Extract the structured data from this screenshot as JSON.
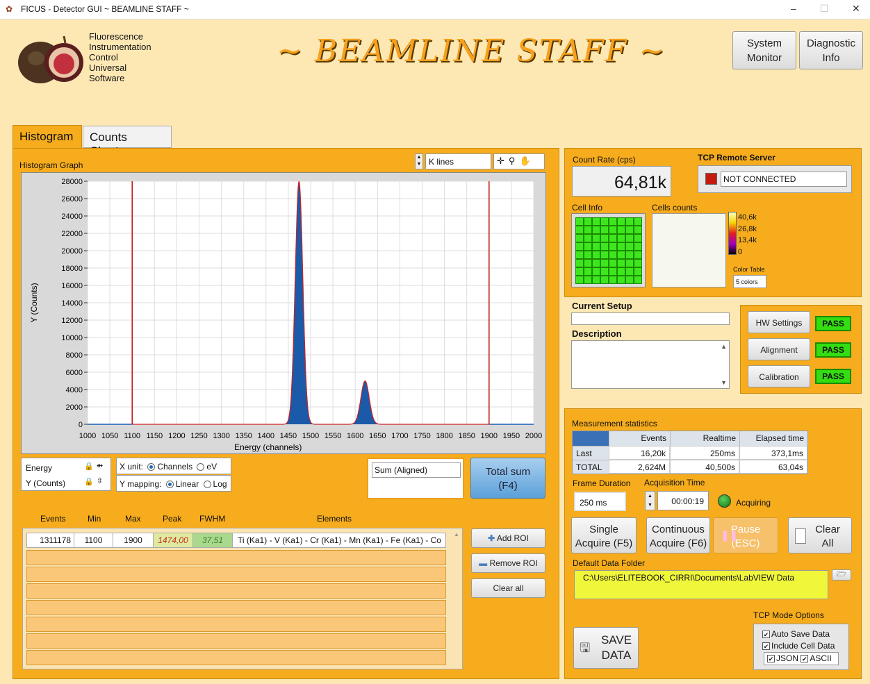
{
  "window": {
    "title": "FICUS - Detector GUI ~ BEAMLINE STAFF ~",
    "minimize": "–",
    "maximize": "☐",
    "close": "✕"
  },
  "logo": {
    "lines": [
      "Fluorescence",
      "Instrumentation",
      "Control",
      "Universal",
      "Software"
    ]
  },
  "banner": "~ BEAMLINE STAFF ~",
  "header_buttons": {
    "system_monitor": "System Monitor",
    "diagnostic_info": "Diagnostic Info"
  },
  "tabs": [
    "Histogram",
    "Counts Charts"
  ],
  "histogram": {
    "title": "Histogram Graph",
    "line_selector": "K lines",
    "xlabel": "Energy (channels)",
    "ylabel": "Y (Counts)"
  },
  "chart_data": {
    "type": "area",
    "xlabel": "Energy (channels)",
    "ylabel": "Y (Counts)",
    "xlim": [
      1000,
      2000
    ],
    "ylim": [
      0,
      28000
    ],
    "x_ticks": [
      1000,
      1050,
      1100,
      1150,
      1200,
      1250,
      1300,
      1350,
      1400,
      1450,
      1500,
      1550,
      1600,
      1650,
      1700,
      1750,
      1800,
      1850,
      1900,
      1950,
      2000
    ],
    "y_ticks": [
      0,
      2000,
      4000,
      6000,
      8000,
      10000,
      12000,
      14000,
      16000,
      18000,
      20000,
      22000,
      24000,
      26000,
      28000
    ],
    "roi_lines": [
      1100,
      1900
    ],
    "peaks": [
      {
        "center": 1474,
        "height": 28000,
        "fwhm": 20
      },
      {
        "center": 1622,
        "height": 5000,
        "fwhm": 22
      }
    ],
    "grid": true,
    "color": "#1a5aa8"
  },
  "axis_legend": {
    "energy": "Energy",
    "ycounts": "Y (Counts)"
  },
  "x_unit": {
    "label": "X unit:",
    "options": [
      "Channels",
      "eV"
    ],
    "selected": "Channels"
  },
  "y_mapping": {
    "label": "Y mapping:",
    "options": [
      "Linear",
      "Log"
    ],
    "selected": "Linear"
  },
  "sum_field": "Sum (Aligned)",
  "total_sum": {
    "line1": "Total sum",
    "line2": "(F4)"
  },
  "roi_table": {
    "headers": [
      "Events",
      "Min",
      "Max",
      "Peak",
      "FWHM",
      "Elements"
    ],
    "rows": [
      [
        "1311178",
        "1100",
        "1900",
        "1474,00",
        "37,51",
        "Ti (Ka1) - V (Ka1) - Cr (Ka1) - Mn (Ka1) - Fe (Ka1) - Co"
      ]
    ]
  },
  "roi_buttons": {
    "add": "Add ROI",
    "remove": "Remove ROI",
    "clear": "Clear all"
  },
  "count_rate": {
    "label": "Count Rate (cps)",
    "value": "64,81k"
  },
  "tcp": {
    "label": "TCP Remote Server",
    "status": "NOT CONNECTED"
  },
  "cell_info": "Cell Info",
  "cells_counts": "Cells counts",
  "color_scale": [
    "40,6k",
    "26,8k",
    "13,4k",
    "0"
  ],
  "color_table": {
    "label": "Color Table",
    "value": "5 colors"
  },
  "setup": {
    "current": "Current Setup",
    "description": "Description"
  },
  "checks": [
    {
      "button": "HW Settings",
      "status": "PASS"
    },
    {
      "button": "Alignment",
      "status": "PASS"
    },
    {
      "button": "Calibration",
      "status": "PASS"
    }
  ],
  "stats": {
    "title": "Measurement statistics",
    "headers": [
      "Events",
      "Realtime",
      "Elapsed time"
    ],
    "rows": [
      {
        "name": "Last",
        "v": [
          "16,20k",
          "250ms",
          "373,1ms"
        ]
      },
      {
        "name": "TOTAL",
        "v": [
          "2,624M",
          "40,500s",
          "63,04s"
        ]
      }
    ]
  },
  "frame": {
    "label": "Frame Duration",
    "value": "250 ms"
  },
  "acq_time": {
    "label": "Acquisition Time",
    "value": "00:00:19"
  },
  "acquiring": "Acquiring",
  "acq_buttons": {
    "single": [
      "Single",
      "Acquire (F5)"
    ],
    "continuous": [
      "Continuous",
      "Acquire (F6)"
    ],
    "pause": [
      "Pause",
      "(ESC)"
    ],
    "clear": [
      "Clear",
      "All"
    ]
  },
  "data_folder": {
    "label": "Default Data Folder",
    "path": "C:\\Users\\ELITEBOOK_CIRRI\\Documents\\LabVIEW Data"
  },
  "save": [
    "SAVE",
    "DATA"
  ],
  "tcp_mode": {
    "label": "TCP Mode Options",
    "auto_save": "Auto Save Data",
    "include_cell": "Include Cell Data",
    "json": "JSON",
    "ascii": "ASCII"
  }
}
